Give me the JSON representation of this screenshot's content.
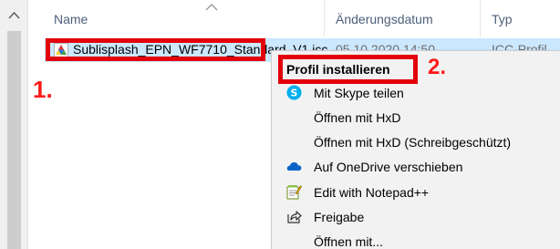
{
  "columns": {
    "name": "Name",
    "date": "Änderungsdatum",
    "type": "Typ"
  },
  "file": {
    "name": "Sublisplash_EPN_WF7710_Standard_V1.icc",
    "date": "05.10.2020 14:50",
    "type": "ICC-Profil",
    "icon": "icc-profile-icon"
  },
  "annotations": {
    "step1": "1.",
    "step2": "2.",
    "highlight_color": "#e3000b",
    "label_color": "#ff1a1a"
  },
  "context_menu": {
    "items": [
      {
        "label": "Profil installieren",
        "icon": "",
        "bold": true
      },
      {
        "label": "Mit Skype teilen",
        "icon": "skype-icon"
      },
      {
        "label": "Öffnen mit HxD",
        "icon": ""
      },
      {
        "label": "Öffnen mit HxD (Schreibgeschützt)",
        "icon": ""
      },
      {
        "label": "Auf OneDrive verschieben",
        "icon": "onedrive-icon"
      },
      {
        "label": "Edit with Notepad++",
        "icon": "notepadpp-icon"
      },
      {
        "label": "Freigabe",
        "icon": "share-icon"
      },
      {
        "label": "Öffnen mit...",
        "icon": ""
      }
    ]
  },
  "colors": {
    "selection": "#cce8ff",
    "header_text": "#4c607a",
    "menu_bg": "#f2f2f2"
  }
}
